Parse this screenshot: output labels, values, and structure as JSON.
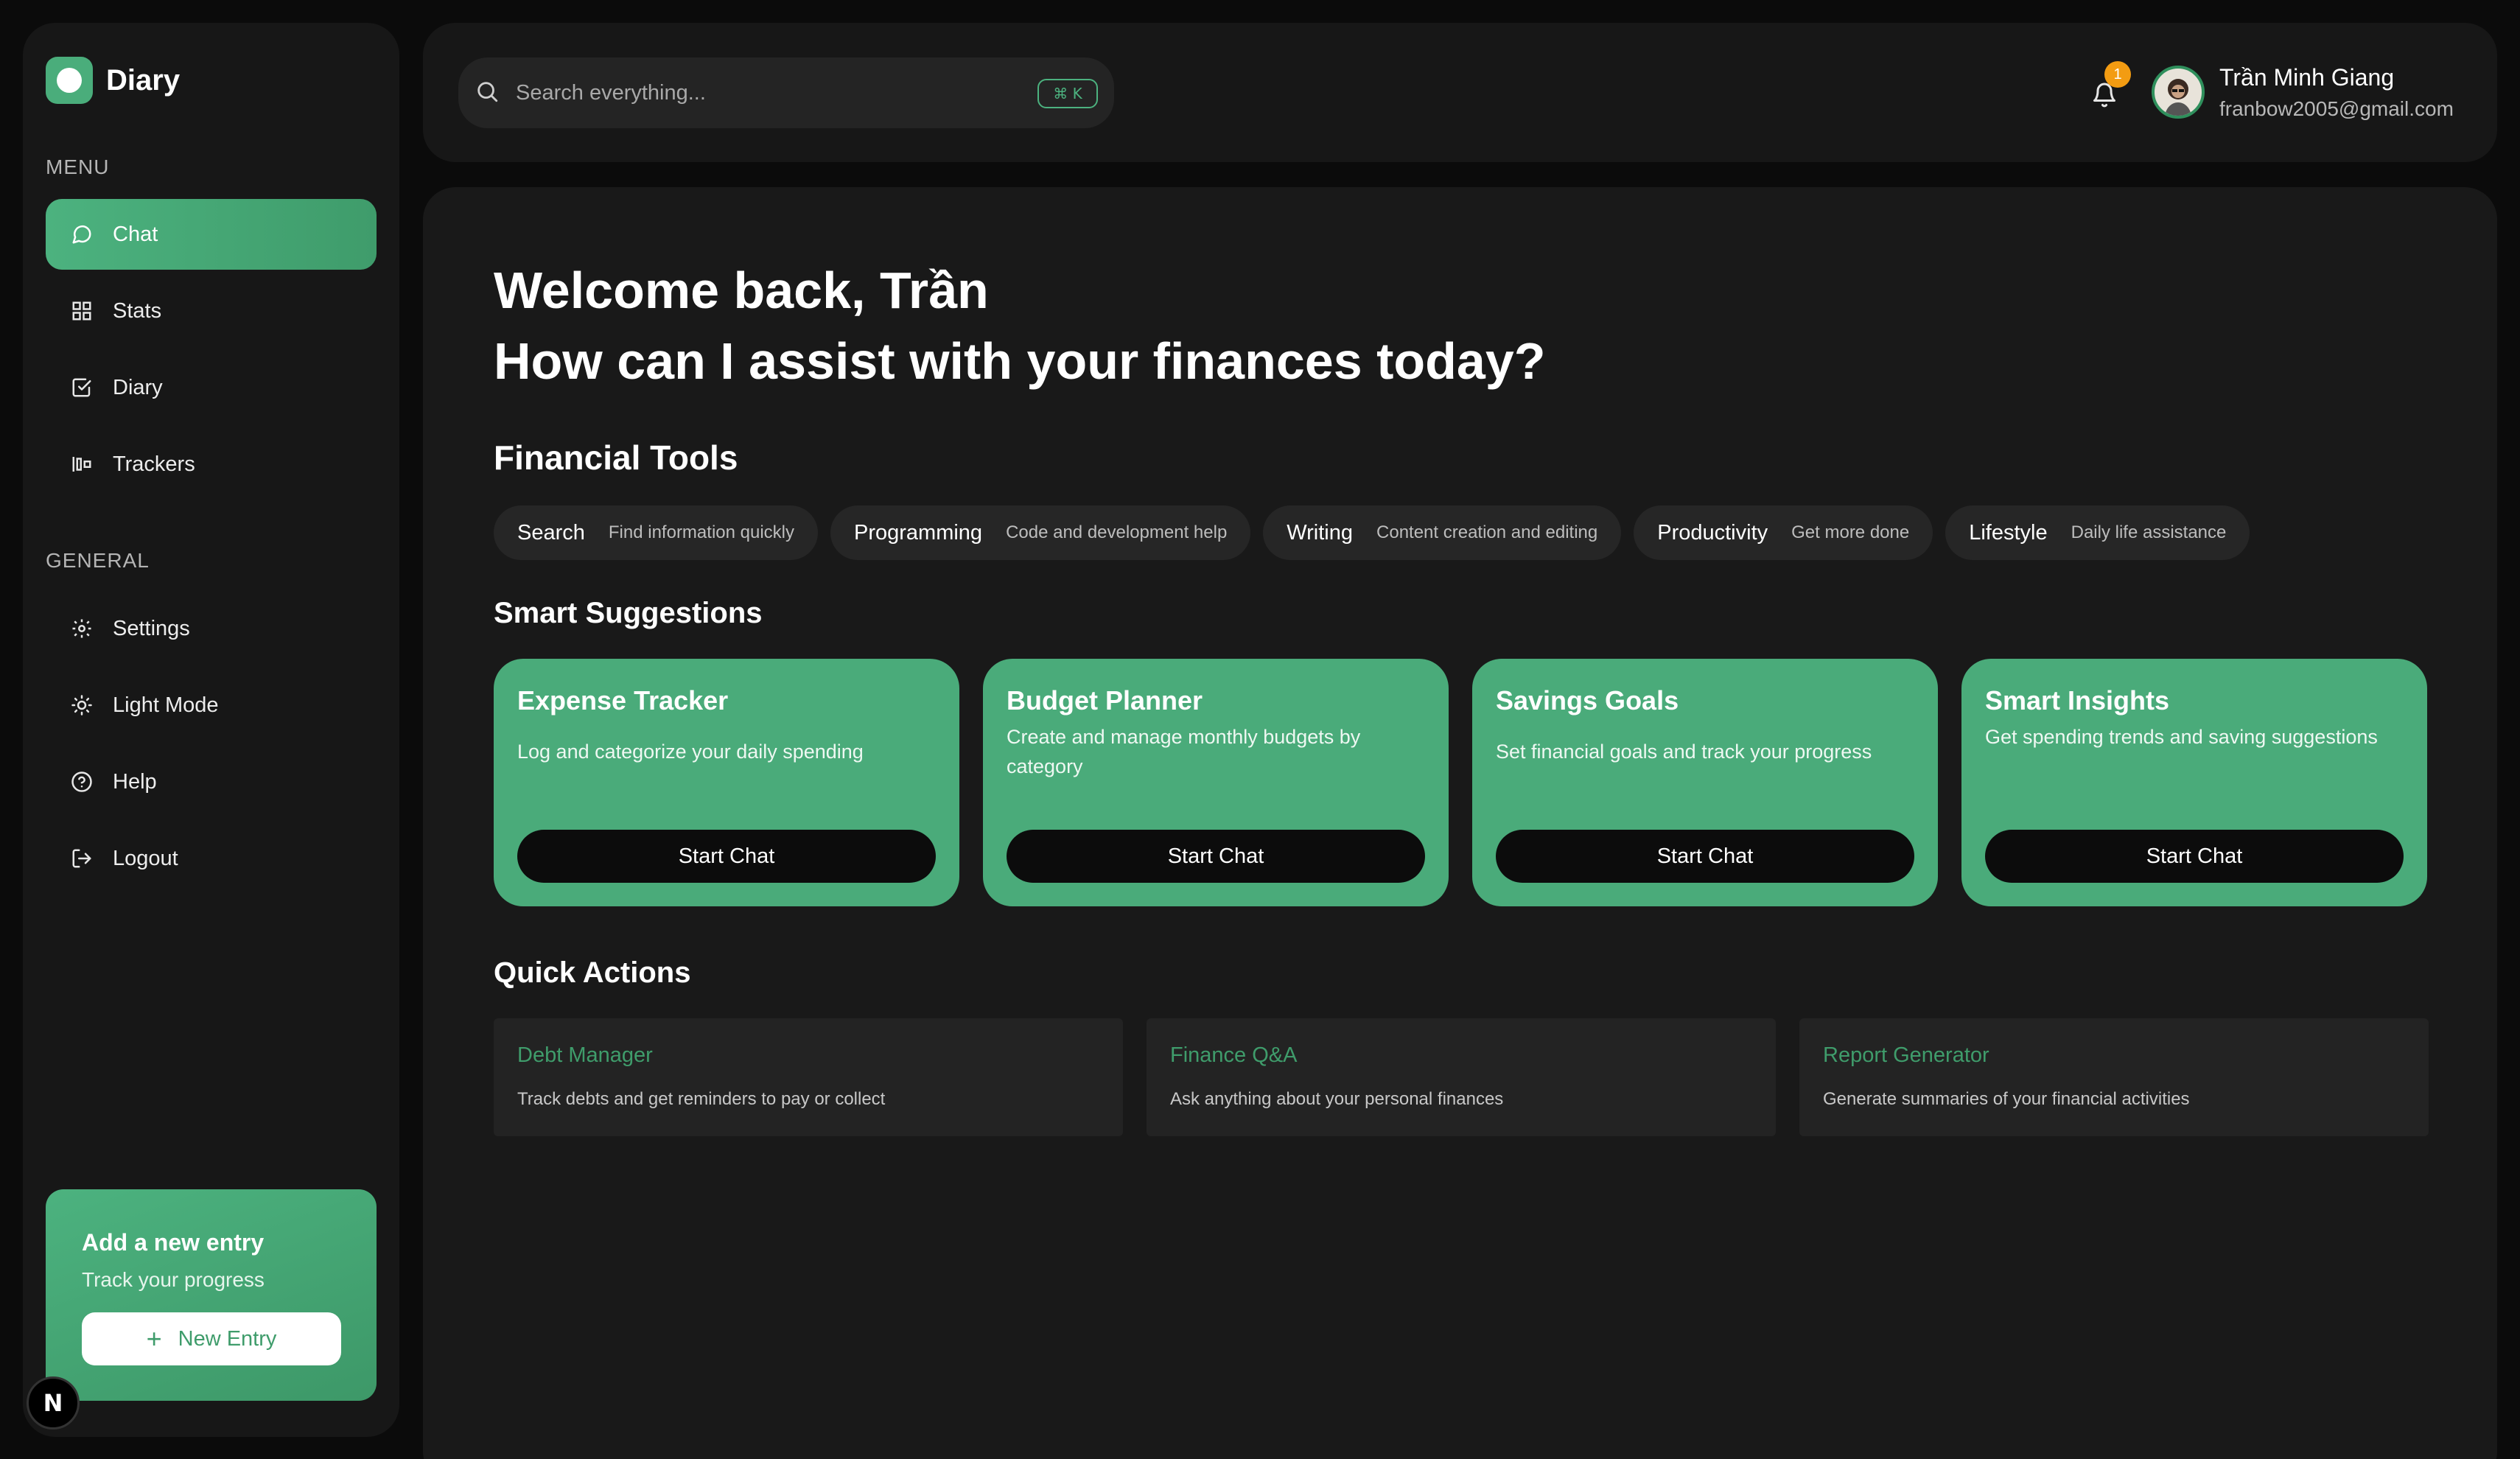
{
  "colors": {
    "accent": "#4aab7a",
    "background": "#0b0b0b",
    "panel": "#171717",
    "badge": "#f39c12"
  },
  "brand": {
    "name": "Diary",
    "icon": "app-logo-icon"
  },
  "sidebar": {
    "menu_label": "MENU",
    "menu_items": [
      {
        "label": "Chat",
        "icon": "chat-bubble-icon",
        "active": true
      },
      {
        "label": "Stats",
        "icon": "grid-icon"
      },
      {
        "label": "Diary",
        "icon": "checkbox-icon"
      },
      {
        "label": "Trackers",
        "icon": "bar-tracker-icon"
      }
    ],
    "general_label": "GENERAL",
    "general_items": [
      {
        "label": "Settings",
        "icon": "gear-icon"
      },
      {
        "label": "Light Mode",
        "icon": "sun-icon"
      },
      {
        "label": "Help",
        "icon": "help-circle-icon"
      },
      {
        "label": "Logout",
        "icon": "logout-icon"
      }
    ],
    "entry_card": {
      "title": "Add a new entry",
      "subtitle": "Track your progress",
      "button": "New Entry"
    },
    "n_badge": "N"
  },
  "topbar": {
    "search_placeholder": "Search everything...",
    "shortcut": "⌘ K",
    "notification_count": "1",
    "user": {
      "name": "Trần Minh Giang",
      "email": "franbow2005@gmail.com"
    }
  },
  "main": {
    "welcome_line1": "Welcome back, Trần",
    "welcome_line2": "How can I assist with your finances today?",
    "tools_title": "Financial Tools",
    "tools": [
      {
        "title": "Search",
        "desc": "Find information quickly"
      },
      {
        "title": "Programming",
        "desc": "Code and development help"
      },
      {
        "title": "Writing",
        "desc": "Content creation and editing"
      },
      {
        "title": "Productivity",
        "desc": "Get more done"
      },
      {
        "title": "Lifestyle",
        "desc": "Daily life assistance"
      }
    ],
    "suggestions_title": "Smart Suggestions",
    "suggestions": [
      {
        "title": "Expense Tracker",
        "desc": "Log and categorize your daily spending",
        "button": "Start Chat"
      },
      {
        "title": "Budget Planner",
        "desc": "Create and manage monthly budgets by category",
        "button": "Start Chat"
      },
      {
        "title": "Savings Goals",
        "desc": "Set financial goals and track your progress",
        "button": "Start Chat"
      },
      {
        "title": "Smart Insights",
        "desc": "Get spending trends and saving suggestions",
        "button": "Start Chat"
      }
    ],
    "quick_title": "Quick Actions",
    "quick_actions": [
      {
        "title": "Debt Manager",
        "desc": "Track debts and get reminders to pay or collect"
      },
      {
        "title": "Finance Q&A",
        "desc": "Ask anything about your personal finances"
      },
      {
        "title": "Report Generator",
        "desc": "Generate summaries of your financial activities"
      }
    ]
  }
}
